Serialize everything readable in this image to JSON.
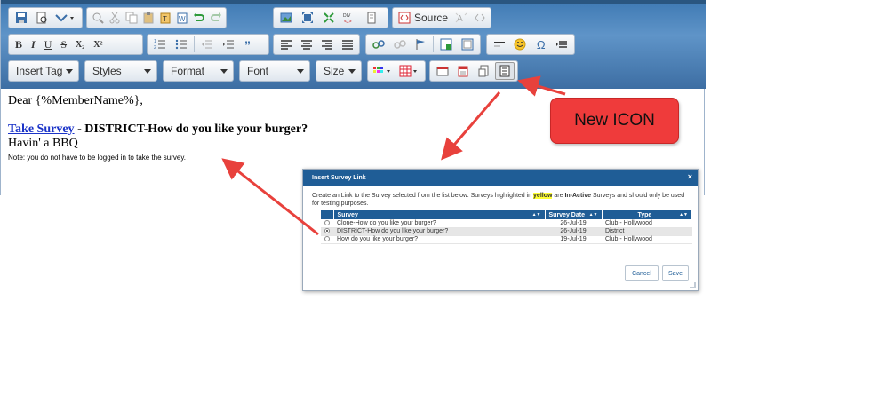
{
  "toolbar": {
    "insert_tag": "Insert Tag",
    "styles": "Styles",
    "format": "Format",
    "font": "Font",
    "size": "Size",
    "source": "Source",
    "bold": "B",
    "italic": "I",
    "underline": "U",
    "strike": "S",
    "subscript": "X₂",
    "superscript": "X²"
  },
  "content": {
    "greeting": "Dear {%MemberName%},",
    "link_text": "Take Survey",
    "headline_rest": " - DISTRICT-How do you like your burger?",
    "line3": "Havin' a BBQ",
    "note": "Note: you do not have to be logged in to take the survey."
  },
  "callout": {
    "text": "New ICON"
  },
  "dialog": {
    "title": "Insert Survey Link",
    "close": "×",
    "desc_part1": "Create an Link to the Survey selected from the list below. Surveys highlighted in ",
    "desc_highlight": "yellow",
    "desc_part2": " are ",
    "desc_bold": "In-Active",
    "desc_part3": " Surveys and should only be used for testing purposes.",
    "columns": [
      "Survey",
      "Survey Date",
      "Type"
    ],
    "rows": [
      {
        "survey": "Clone-How do you like your burger?",
        "date": "26-Jul-19",
        "type": "Club - Hollywood"
      },
      {
        "survey": "DISTRICT-How do you like your burger?",
        "date": "26-Jul-19",
        "type": "District"
      },
      {
        "survey": "How do you like your burger?",
        "date": "19-Jul-19",
        "type": "Club - Hollywood"
      }
    ],
    "cancel": "Cancel",
    "save": "Save"
  },
  "colors": {
    "toolbar": "#3e79b3",
    "dialog_header": "#1f5d96",
    "callout": "#ef3b3b",
    "arrow": "#e8413c",
    "highlight": "#ffff33"
  }
}
